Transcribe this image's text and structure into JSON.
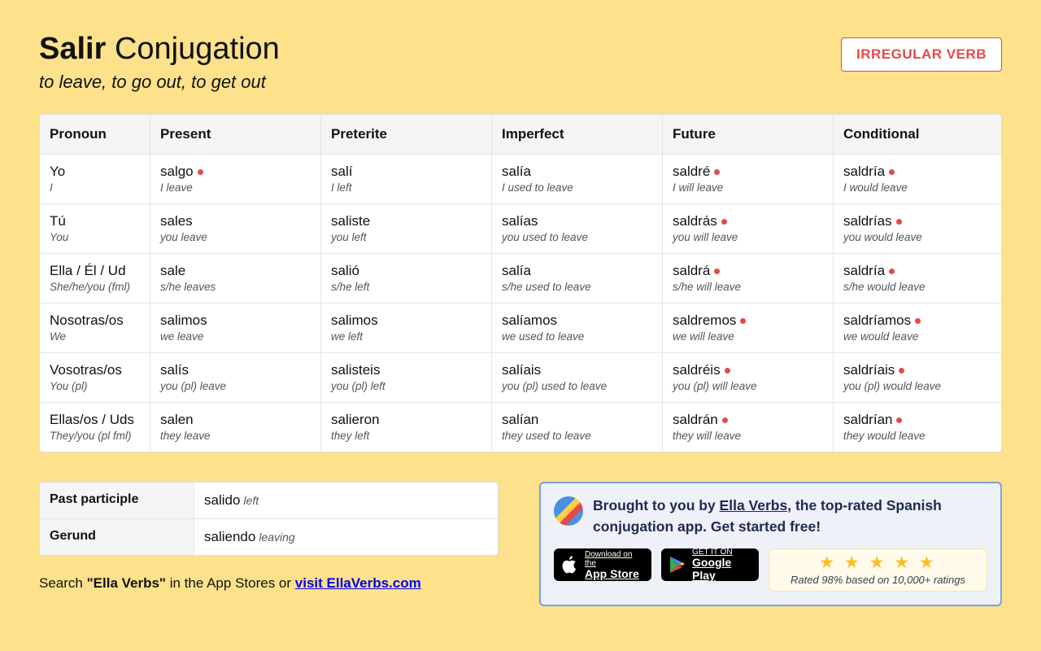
{
  "header": {
    "verb": "Salir",
    "conj_word": "Conjugation",
    "subtitle": "to leave, to go out, to get out",
    "badge": "IRREGULAR VERB"
  },
  "columns": [
    "Pronoun",
    "Present",
    "Preterite",
    "Imperfect",
    "Future",
    "Conditional"
  ],
  "pronouns": [
    {
      "sp": "Yo",
      "en": "I"
    },
    {
      "sp": "Tú",
      "en": "You"
    },
    {
      "sp": "Ella / Él / Ud",
      "en": "She/he/you (fml)"
    },
    {
      "sp": "Nosotras/os",
      "en": "We"
    },
    {
      "sp": "Vosotras/os",
      "en": "You (pl)"
    },
    {
      "sp": "Ellas/os / Uds",
      "en": "They/you (pl fml)"
    }
  ],
  "tenses": {
    "Present": [
      {
        "w": "salgo",
        "t": "I leave",
        "irr": true
      },
      {
        "w": "sales",
        "t": "you leave"
      },
      {
        "w": "sale",
        "t": "s/he leaves"
      },
      {
        "w": "salimos",
        "t": "we leave"
      },
      {
        "w": "salís",
        "t": "you (pl) leave"
      },
      {
        "w": "salen",
        "t": "they leave"
      }
    ],
    "Preterite": [
      {
        "w": "salí",
        "t": "I left"
      },
      {
        "w": "saliste",
        "t": "you left"
      },
      {
        "w": "salió",
        "t": "s/he left"
      },
      {
        "w": "salimos",
        "t": "we left"
      },
      {
        "w": "salisteis",
        "t": "you (pl) left"
      },
      {
        "w": "salieron",
        "t": "they left"
      }
    ],
    "Imperfect": [
      {
        "w": "salía",
        "t": "I used to leave"
      },
      {
        "w": "salías",
        "t": "you used to leave"
      },
      {
        "w": "salía",
        "t": "s/he used to leave"
      },
      {
        "w": "salíamos",
        "t": "we used to leave"
      },
      {
        "w": "salíais",
        "t": "you (pl) used to leave"
      },
      {
        "w": "salían",
        "t": "they used to leave"
      }
    ],
    "Future": [
      {
        "w": "saldré",
        "t": "I will leave",
        "irr": true
      },
      {
        "w": "saldrás",
        "t": "you will leave",
        "irr": true
      },
      {
        "w": "saldrá",
        "t": "s/he will leave",
        "irr": true
      },
      {
        "w": "saldremos",
        "t": "we will leave",
        "irr": true
      },
      {
        "w": "saldréis",
        "t": "you (pl) will leave",
        "irr": true
      },
      {
        "w": "saldrán",
        "t": "they will leave",
        "irr": true
      }
    ],
    "Conditional": [
      {
        "w": "saldría",
        "t": "I would leave",
        "irr": true
      },
      {
        "w": "saldrías",
        "t": "you would leave",
        "irr": true
      },
      {
        "w": "saldría",
        "t": "s/he would leave",
        "irr": true
      },
      {
        "w": "saldríamos",
        "t": "we would leave",
        "irr": true
      },
      {
        "w": "saldríais",
        "t": "you (pl) would leave",
        "irr": true
      },
      {
        "w": "saldrían",
        "t": "they would leave",
        "irr": true
      }
    ]
  },
  "participles": {
    "pp_label": "Past participle",
    "pp_w": "salido",
    "pp_t": "left",
    "ger_label": "Gerund",
    "ger_w": "saliendo",
    "ger_t": "leaving"
  },
  "search_note": {
    "prefix": "Search ",
    "quote": "\"Ella Verbs\"",
    "mid": " in the App Stores or ",
    "link": "visit EllaVerbs.com"
  },
  "promo": {
    "line1": "Brought to you by ",
    "link": "Ella Verbs",
    "line2": ", the top-rated Spanish conjugation app. Get started free!",
    "appstore_small": "Download on the",
    "appstore_big": "App Store",
    "gplay_small": "GET IT ON",
    "gplay_big": "Google Play",
    "rating_text": "Rated 98% based on 10,000+ ratings"
  }
}
